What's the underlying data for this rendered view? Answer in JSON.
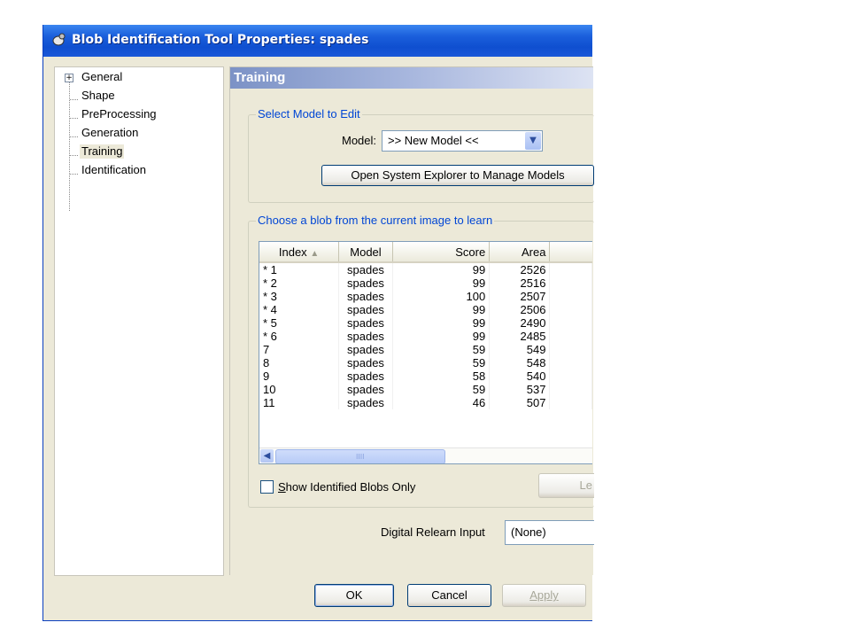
{
  "window": {
    "title": "Blob Identification Tool Properties: spades"
  },
  "tree": {
    "items": [
      {
        "label": "General",
        "expandable": true
      },
      {
        "label": "Shape"
      },
      {
        "label": "PreProcessing"
      },
      {
        "label": "Generation"
      },
      {
        "label": "Training",
        "selected": true
      },
      {
        "label": "Identification"
      }
    ]
  },
  "panel": {
    "title": "Training",
    "select_model": {
      "legend": "Select Model to Edit",
      "model_label": "Model:",
      "model_value": ">> New Model <<",
      "open_explorer_button": "Open System Explorer to Manage Models"
    },
    "choose_blob": {
      "legend": "Choose a blob from the current image to learn",
      "columns": [
        "Index",
        "Model",
        "Score",
        "Area"
      ],
      "rows": [
        {
          "index": "* 1",
          "model": "spades",
          "score": "99",
          "area": "2526"
        },
        {
          "index": "* 2",
          "model": "spades",
          "score": "99",
          "area": "2516"
        },
        {
          "index": "* 3",
          "model": "spades",
          "score": "100",
          "area": "2507"
        },
        {
          "index": "* 4",
          "model": "spades",
          "score": "99",
          "area": "2506"
        },
        {
          "index": "* 5",
          "model": "spades",
          "score": "99",
          "area": "2490"
        },
        {
          "index": "* 6",
          "model": "spades",
          "score": "99",
          "area": "2485"
        },
        {
          "index": "7",
          "model": "spades",
          "score": "59",
          "area": "549"
        },
        {
          "index": "8",
          "model": "spades",
          "score": "59",
          "area": "548"
        },
        {
          "index": "9",
          "model": "spades",
          "score": "58",
          "area": "540"
        },
        {
          "index": "10",
          "model": "spades",
          "score": "59",
          "area": "537"
        },
        {
          "index": "11",
          "model": "spades",
          "score": "46",
          "area": "507"
        }
      ],
      "scroll_grip": "IIII",
      "show_identified_label": "Show Identified Blobs Only",
      "show_identified_accesskey": "S",
      "show_identified_rest": "how Identified Blobs Only",
      "learn_button_partial": "Le"
    },
    "digital_relearn": {
      "label": "Digital Relearn Input",
      "value": "(None)"
    }
  },
  "buttons": {
    "ok": "OK",
    "cancel": "Cancel",
    "apply": "Apply"
  },
  "colors": {
    "title_bar": "#0f4fd0",
    "legend_text": "#0046d5",
    "dialog_bg": "#ece9d8"
  }
}
